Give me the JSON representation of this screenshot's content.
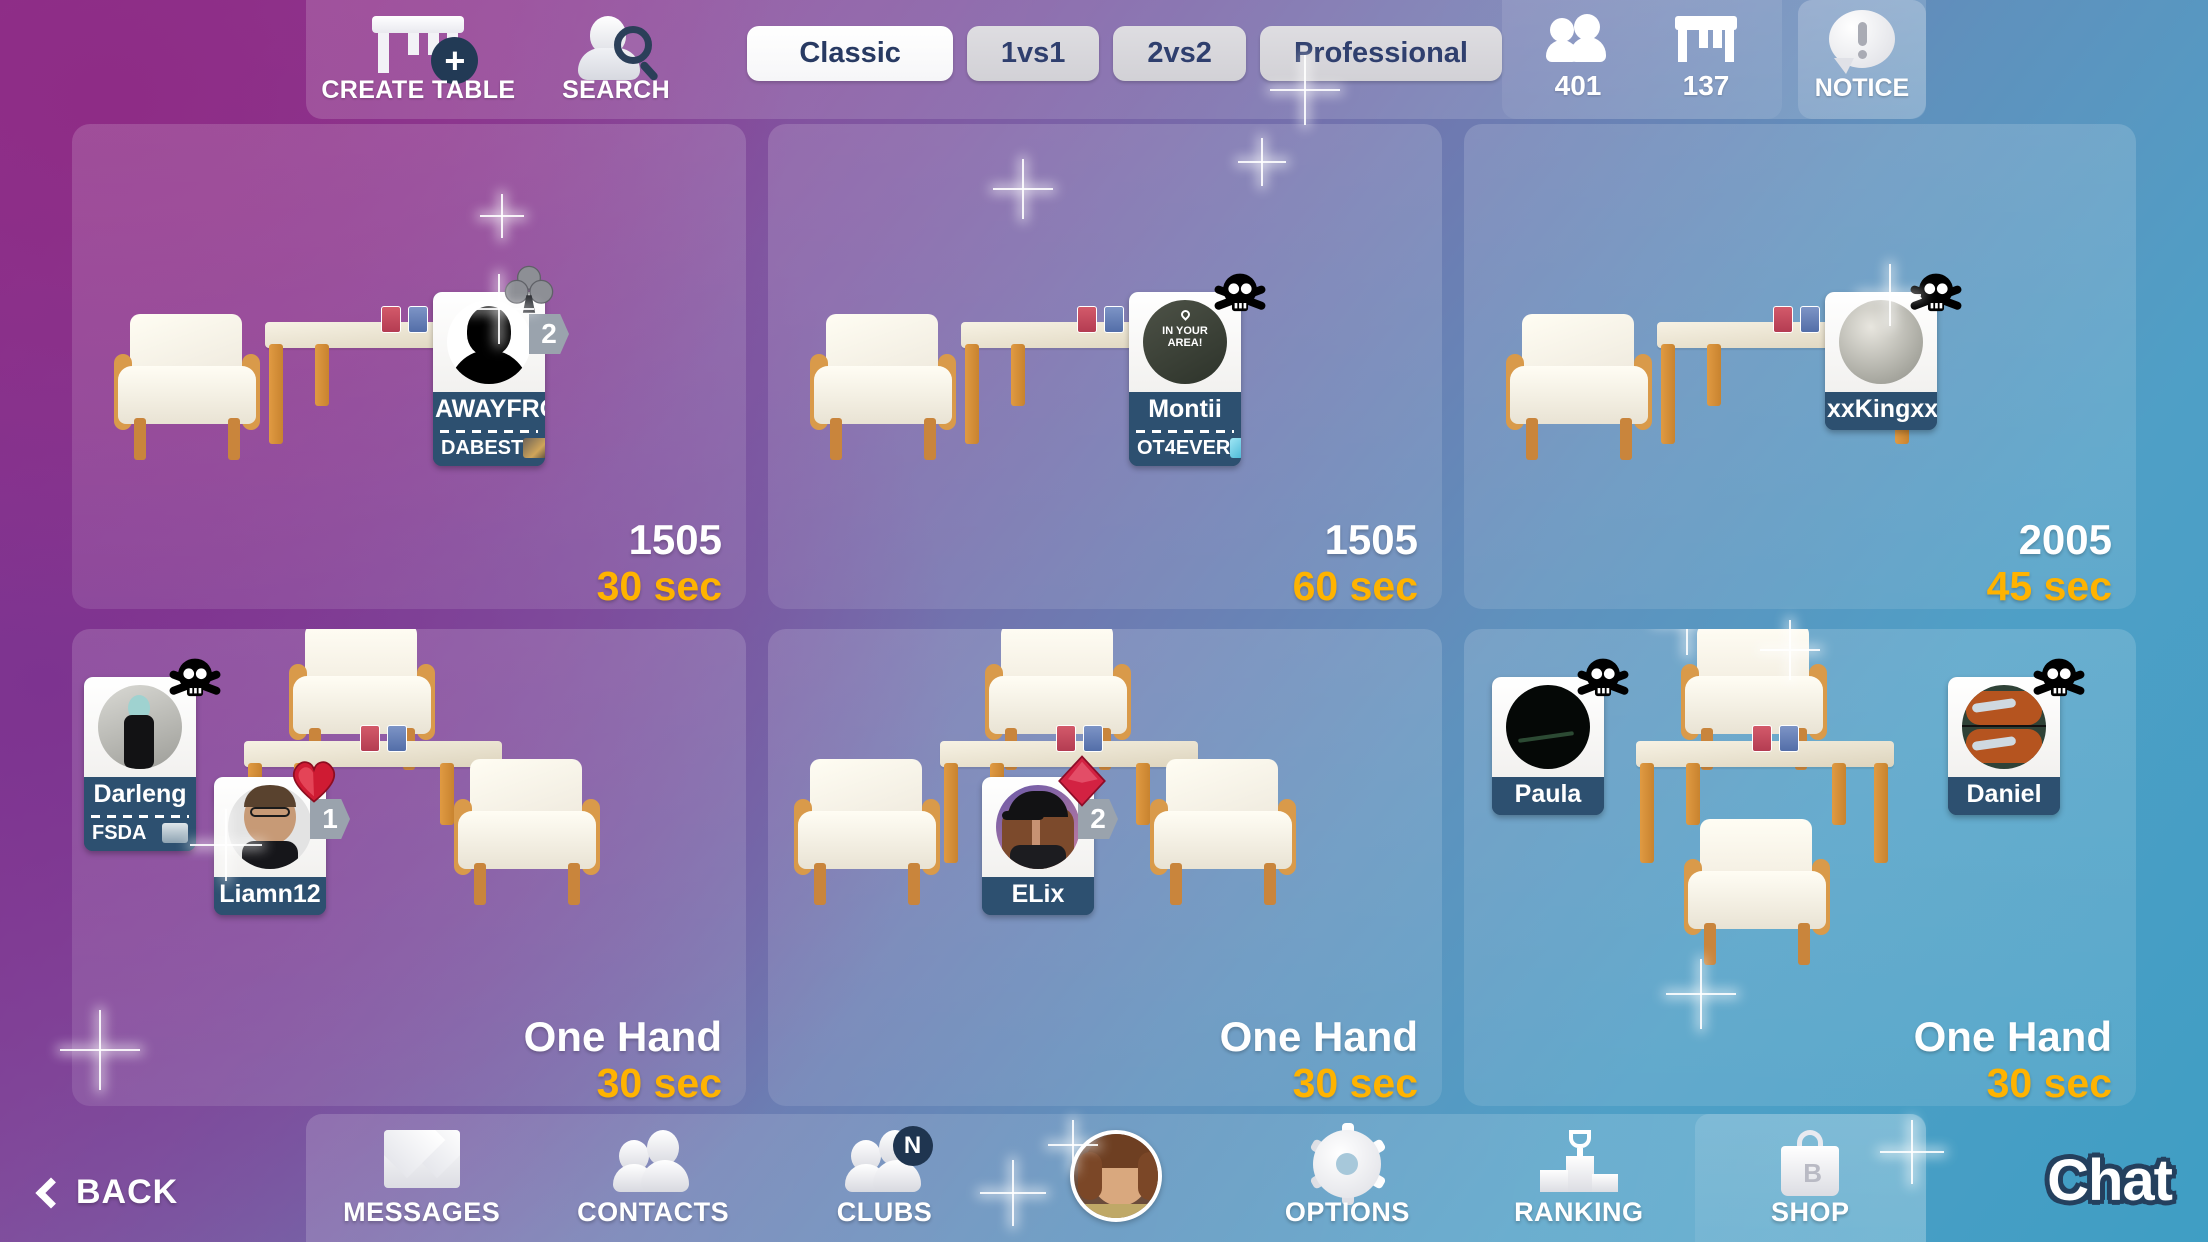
{
  "topbar": {
    "create_table": {
      "label": "CREATE TABLE",
      "icon": "table-plus-icon"
    },
    "search": {
      "label": "SEARCH",
      "icon": "person-search-icon"
    },
    "modes": [
      {
        "label": "Classic",
        "active": true
      },
      {
        "label": "1vs1",
        "active": false
      },
      {
        "label": "2vs2",
        "active": false
      },
      {
        "label": "Professional",
        "active": false
      }
    ],
    "counters": [
      {
        "icon": "people-icon",
        "value": "401"
      },
      {
        "icon": "table-icon",
        "value": "137"
      }
    ],
    "notice": {
      "label": "NOTICE",
      "icon": "notice-bubble-icon"
    }
  },
  "tables": [
    {
      "id": "table-1",
      "game": "1505",
      "timer": "30 sec",
      "players": [
        {
          "name": "AWAYFRO",
          "club": "DABEST",
          "seat": "2",
          "marker": "club-suit",
          "skull": false,
          "avatar_kind": "silhouette"
        }
      ]
    },
    {
      "id": "table-2",
      "game": "1505",
      "timer": "60 sec",
      "players": [
        {
          "name": "Montii",
          "club": "OT4EVER",
          "seat": "",
          "marker": "none",
          "skull": true,
          "avatar_kind": "in-your-area"
        }
      ]
    },
    {
      "id": "table-3",
      "game": "2005",
      "timer": "45 sec",
      "players": [
        {
          "name": "xxKingxx",
          "club": "",
          "seat": "",
          "marker": "none",
          "skull": true,
          "avatar_kind": "sphere"
        }
      ]
    },
    {
      "id": "table-4",
      "game": "One Hand",
      "timer": "30 sec",
      "players": [
        {
          "name": "Darleng",
          "club": "FSDA",
          "seat": "",
          "marker": "none",
          "skull": true,
          "avatar_kind": "photo-dark"
        },
        {
          "name": "Liamn12",
          "club": "",
          "seat": "1",
          "marker": "heart-suit",
          "skull": false,
          "avatar_kind": "photo-man"
        }
      ]
    },
    {
      "id": "table-5",
      "game": "One Hand",
      "timer": "30 sec",
      "players": [
        {
          "name": "ELix",
          "club": "",
          "seat": "2",
          "marker": "diamond-suit",
          "skull": false,
          "avatar_kind": "photo-cap"
        }
      ]
    },
    {
      "id": "table-6",
      "game": "One Hand",
      "timer": "30 sec",
      "players": [
        {
          "name": "Paula",
          "club": "",
          "seat": "",
          "marker": "none",
          "skull": true,
          "avatar_kind": "photo-black"
        },
        {
          "name": "Daniel",
          "club": "",
          "seat": "",
          "marker": "none",
          "skull": true,
          "avatar_kind": "photo-meme"
        }
      ]
    }
  ],
  "bottombar": {
    "back": {
      "label": "BACK",
      "icon": "chevron-left-icon"
    },
    "nav": [
      {
        "label": "MESSAGES",
        "icon": "mail-icon",
        "badge": ""
      },
      {
        "label": "CONTACTS",
        "icon": "contacts-icon",
        "badge": ""
      },
      {
        "label": "CLUBS",
        "icon": "clubs-icon",
        "badge": "N"
      },
      {
        "label": "",
        "icon": "profile-avatar",
        "badge": ""
      },
      {
        "label": "OPTIONS",
        "icon": "gear-icon",
        "badge": ""
      },
      {
        "label": "RANKING",
        "icon": "podium-trophy-icon",
        "badge": ""
      },
      {
        "label": "SHOP",
        "icon": "shop-bag-icon",
        "badge": ""
      }
    ],
    "chat": {
      "label": "Chat"
    }
  },
  "colors": {
    "accent_timer": "#ffb300",
    "badge_bar": "#2d5070",
    "mode_text": "#2f3f6e",
    "plus_badge": "#223a55"
  }
}
